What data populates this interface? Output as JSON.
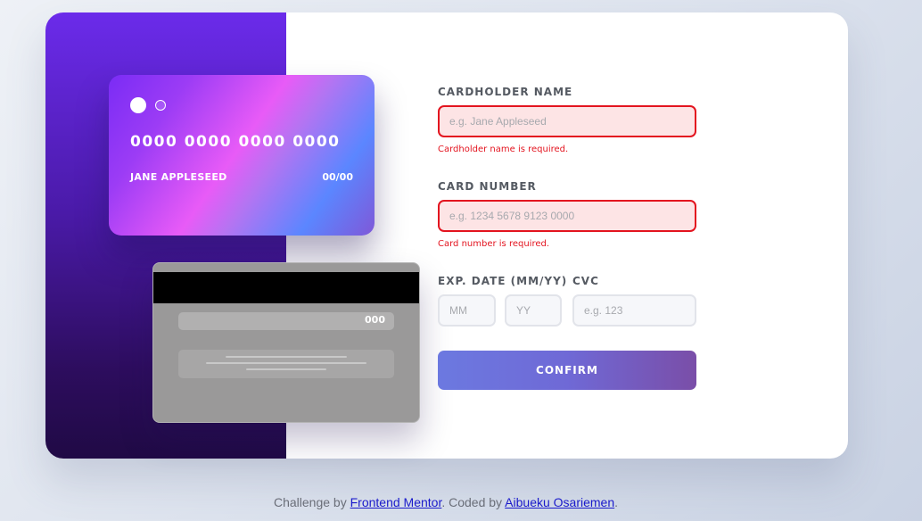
{
  "card_front": {
    "number": "0000 0000 0000 0000",
    "name": "JANE APPLESEED",
    "expiry": "00/00"
  },
  "card_back": {
    "cvc": "000"
  },
  "form": {
    "cardholder": {
      "label": "CARDHOLDER NAME",
      "placeholder": "e.g. Jane Appleseed",
      "value": "",
      "error": "Cardholder name is required."
    },
    "card_number": {
      "label": "CARD NUMBER",
      "placeholder": "e.g. 1234 5678 9123 0000",
      "value": "",
      "error": "Card number is required."
    },
    "exp_date": {
      "label": "EXP. DATE (MM/YY)",
      "month_placeholder": "MM",
      "year_placeholder": "YY"
    },
    "cvc": {
      "label": "CVC",
      "placeholder": "e.g. 123"
    },
    "confirm_label": "CONFIRM"
  },
  "footer": {
    "prefix": "Challenge by ",
    "mentor_link": "Frontend Mentor",
    "middle": ". Coded by ",
    "author_link": "Aibueku Osariemen",
    "suffix": "."
  },
  "colors": {
    "error": "#e3141f",
    "error_bg": "#fde4e5",
    "accent_start": "#6c79e0",
    "accent_end": "#7a4ea8",
    "panel_dark": "#200a45"
  }
}
